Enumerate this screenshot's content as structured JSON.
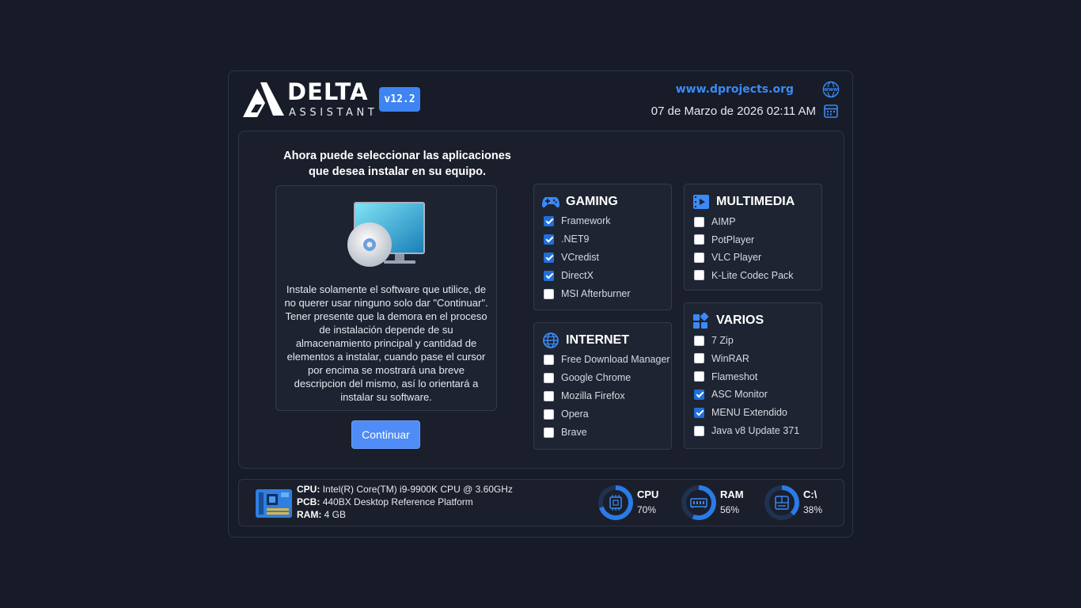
{
  "header": {
    "brand_title": "DELTA",
    "brand_subtitle": "ASSISTANT",
    "version": "v12.2",
    "website": "www.dprojects.org",
    "datetime": "07 de Marzo de 2026  02:11 AM"
  },
  "intro": {
    "title_line1": "Ahora puede seleccionar las aplicaciones",
    "title_line2": "que desea instalar en su equipo.",
    "description": "Instale solamente el software que utilice, de no querer usar ninguno solo dar \"Continuar\". Tener presente que la demora en el proceso de instalación depende de su almacenamiento principal y cantidad de elementos a instalar, cuando pase el cursor por encima se mostrará una breve descripcion del mismo, así lo orientará a instalar su software.",
    "continue_label": "Continuar"
  },
  "groups": {
    "gaming": {
      "title": "GAMING",
      "items": [
        {
          "label": "Framework",
          "checked": true
        },
        {
          "label": ".NET9",
          "checked": true
        },
        {
          "label": "VCredist",
          "checked": true
        },
        {
          "label": "DirectX",
          "checked": true
        },
        {
          "label": "MSI Afterburner",
          "checked": false
        }
      ]
    },
    "multimedia": {
      "title": "MULTIMEDIA",
      "items": [
        {
          "label": "AIMP",
          "checked": false
        },
        {
          "label": "PotPlayer",
          "checked": false
        },
        {
          "label": "VLC Player",
          "checked": false
        },
        {
          "label": "K-Lite Codec Pack",
          "checked": false
        }
      ]
    },
    "internet": {
      "title": "INTERNET",
      "items": [
        {
          "label": "Free Download Manager",
          "checked": false
        },
        {
          "label": "Google Chrome",
          "checked": false
        },
        {
          "label": "Mozilla Firefox",
          "checked": false
        },
        {
          "label": "Opera",
          "checked": false
        },
        {
          "label": "Brave",
          "checked": false
        }
      ]
    },
    "varios": {
      "title": "VARIOS",
      "items": [
        {
          "label": "7 Zip",
          "checked": false
        },
        {
          "label": "WinRAR",
          "checked": false
        },
        {
          "label": "Flameshot",
          "checked": false
        },
        {
          "label": "ASC Monitor",
          "checked": true
        },
        {
          "label": "MENU Extendido",
          "checked": true
        },
        {
          "label": "Java v8 Update 371",
          "checked": false
        }
      ]
    }
  },
  "system": {
    "cpu_label": "CPU:",
    "cpu_value": "Intel(R) Core(TM) i9-9900K CPU @ 3.60GHz",
    "pcb_label": "PCB:",
    "pcb_value": "440BX Desktop Reference Platform",
    "ram_label": "RAM:",
    "ram_value": "4 GB"
  },
  "gauges": [
    {
      "label": "CPU",
      "value_text": "70%",
      "percent": 70,
      "icon": "cpu-icon"
    },
    {
      "label": "RAM",
      "value_text": "56%",
      "percent": 56,
      "icon": "ram-icon"
    },
    {
      "label": "C:\\",
      "value_text": "38%",
      "percent": 38,
      "icon": "drive-icon"
    }
  ],
  "colors": {
    "accent": "#3e84f2",
    "check": "#1f6fdb",
    "gauge_fill": "#2a7be6",
    "gauge_track": "#1f3250"
  }
}
